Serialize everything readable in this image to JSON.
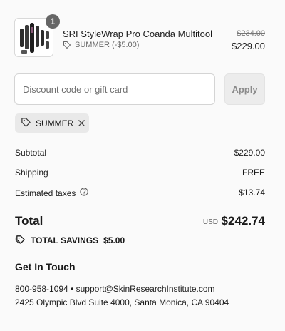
{
  "line_item": {
    "quantity": "1",
    "name": "SRI StyleWrap Pro Coanda Multitool",
    "discount_label": "SUMMER (-$5.00)",
    "original_price": "$234.00",
    "price": "$229.00",
    "image_icon": "hair-styler-tools-thumbnail"
  },
  "discount": {
    "placeholder": "Discount code or gift card",
    "value": "",
    "apply_label": "Apply",
    "applied_code": "SUMMER",
    "tag_icon": "tag-icon",
    "remove_icon": "close-icon"
  },
  "summary": {
    "subtotal_label": "Subtotal",
    "subtotal_value": "$229.00",
    "shipping_label": "Shipping",
    "shipping_value": "FREE",
    "taxes_label": "Estimated taxes",
    "taxes_value": "$13.74",
    "total_label": "Total",
    "currency": "USD",
    "total_value": "$242.74",
    "savings_label": "TOTAL SAVINGS",
    "savings_value": "$5.00"
  },
  "contact": {
    "heading": "Get In Touch",
    "line1": "800-958-1094 • support@SkinResearchInstitute.com",
    "line2": "2425 Olympic Blvd Suite 4000, Santa Monica, CA 90404"
  },
  "colors": {
    "background": "#fafafa",
    "badge": "#666666",
    "chip": "#e9e9e9",
    "apply_button": "#ececec"
  }
}
